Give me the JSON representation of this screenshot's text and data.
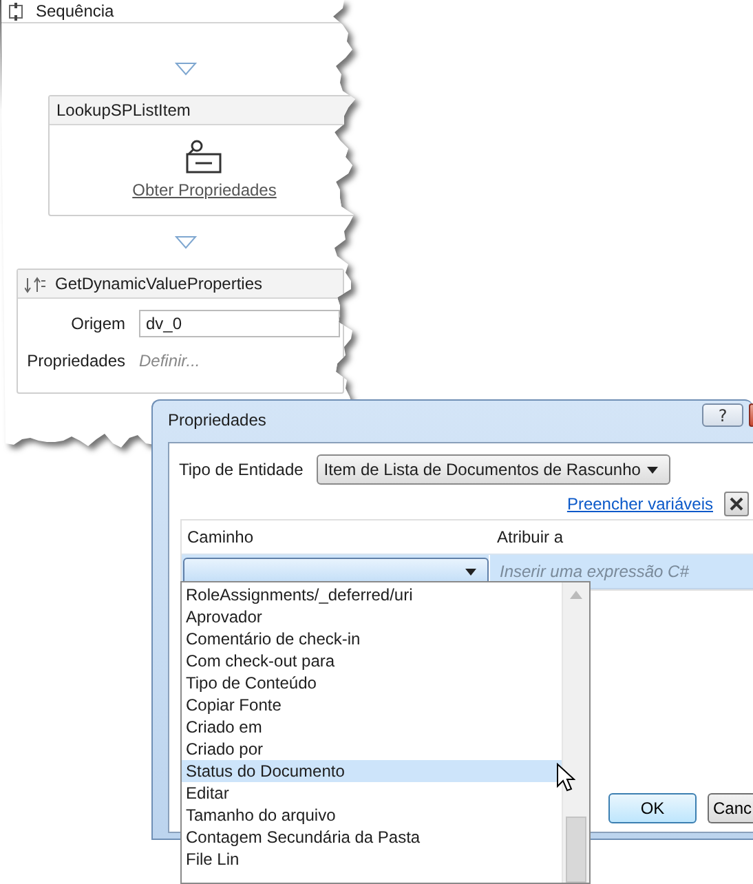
{
  "workflow": {
    "title": "Sequência",
    "activities": [
      {
        "kind": "icon-card",
        "title": "LookupSPListItem",
        "link": "Obter Propriedades"
      },
      {
        "kind": "form-card",
        "title": "GetDynamicValueProperties",
        "fields": [
          {
            "label": "Origem",
            "value": "dv_0"
          },
          {
            "label": "Propriedades",
            "placeholder": "Definir..."
          }
        ]
      }
    ]
  },
  "dialog": {
    "title": "Propriedades",
    "help_button": "?",
    "entity_type": {
      "label": "Tipo de Entidade",
      "value": "Item de Lista de Documentos de Rascunho"
    },
    "fill_link": "Preencher variáveis",
    "table": {
      "columns": [
        "Caminho",
        "Atribuir a"
      ],
      "rows": [
        {
          "assign_placeholder": "Inserir uma expressão C#"
        }
      ]
    },
    "dropdown": {
      "items": [
        {
          "label": "RoleAssignments/_deferred/uri",
          "selected": false
        },
        {
          "label": "Aprovador",
          "selected": false
        },
        {
          "label": "Comentário de check-in",
          "selected": false
        },
        {
          "label": "Com check-out para",
          "selected": false
        },
        {
          "label": "Tipo de Conteúdo",
          "selected": false
        },
        {
          "label": "Copiar Fonte",
          "selected": false
        },
        {
          "label": "Criado em",
          "selected": false
        },
        {
          "label": "Criado por",
          "selected": false
        },
        {
          "label": "Status do Documento",
          "selected": true
        },
        {
          "label": "Editar",
          "selected": false
        },
        {
          "label": "Tamanho do arquivo",
          "selected": false
        },
        {
          "label": "Contagem Secundária da Pasta",
          "selected": false
        },
        {
          "label": "File Lin",
          "selected": false
        }
      ]
    },
    "buttons": [
      "OK",
      "Canc"
    ]
  }
}
